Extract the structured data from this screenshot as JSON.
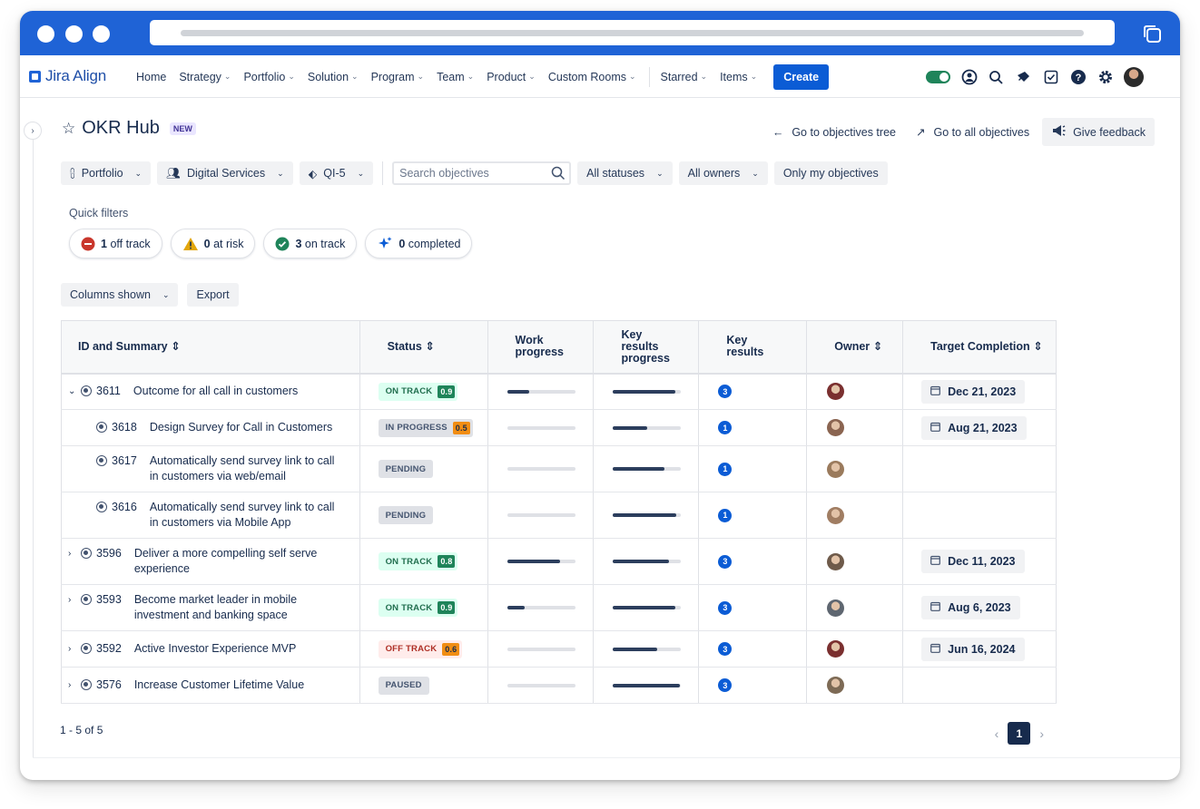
{
  "app": {
    "logo": "Jira Align"
  },
  "nav": {
    "items": [
      {
        "label": "Home",
        "dropdown": false
      },
      {
        "label": "Strategy",
        "dropdown": true
      },
      {
        "label": "Portfolio",
        "dropdown": true
      },
      {
        "label": "Solution",
        "dropdown": true
      },
      {
        "label": "Program",
        "dropdown": true
      },
      {
        "label": "Team",
        "dropdown": true
      },
      {
        "label": "Product",
        "dropdown": true
      },
      {
        "label": "Custom Rooms",
        "dropdown": true
      }
    ],
    "starred": "Starred",
    "items_menu": "Items",
    "create": "Create"
  },
  "page": {
    "title": "OKR Hub",
    "badge": "NEW",
    "go_tree": "Go to objectives tree",
    "go_all": "Go to all objectives",
    "feedback": "Give feedback"
  },
  "filters": {
    "portfolio": "Portfolio",
    "digital": "Digital Services",
    "pi": "QI-5",
    "search_placeholder": "Search objectives",
    "statuses": "All statuses",
    "owners": "All owners",
    "mine": "Only my objectives"
  },
  "quick_filters": {
    "label": "Quick filters",
    "chips": [
      {
        "count": "1",
        "label": "off track",
        "icon": "off-track-icon",
        "color": "#c9372c"
      },
      {
        "count": "0",
        "label": "at risk",
        "icon": "warning-icon",
        "color": "#e2a60b"
      },
      {
        "count": "3",
        "label": "on track",
        "icon": "check-circle-icon",
        "color": "#1f845a"
      },
      {
        "count": "0",
        "label": "completed",
        "icon": "sparkle-icon",
        "color": "#0b5cd5"
      }
    ]
  },
  "tools": {
    "columns": "Columns shown",
    "export": "Export"
  },
  "table": {
    "headers": {
      "id": "ID and Summary",
      "status": "Status",
      "work": [
        "Work",
        "progress"
      ],
      "krp": [
        "Key",
        "results",
        "progress"
      ],
      "kr": [
        "Key",
        "results"
      ],
      "owner": "Owner",
      "target": "Target Completion"
    },
    "rows": [
      {
        "expander": "expanded",
        "indent": 0,
        "id": "3611",
        "summary": [
          "Outcome for all call in customers"
        ],
        "status": "ON TRACK",
        "score": "0.9",
        "status_kind": "ontrack",
        "work": 0.33,
        "krp": 0.92,
        "kr": "3",
        "avatar": "#7a2f2f",
        "date": "Dec 21, 2023",
        "tall": false
      },
      {
        "expander": "none",
        "indent": 1,
        "id": "3618",
        "summary": [
          "Design Survey for Call in Customers"
        ],
        "status": "IN PROGRESS",
        "score": "0.5",
        "status_kind": "inprog",
        "work": 0.0,
        "krp": 0.5,
        "kr": "1",
        "avatar": "#8a6450",
        "date": "Aug 21, 2023",
        "tall": false
      },
      {
        "expander": "none",
        "indent": 1,
        "id": "3617",
        "summary": [
          "Automatically send survey link to call",
          "in customers via web/email"
        ],
        "status": "PENDING",
        "score": "",
        "status_kind": "plain",
        "work": 0.0,
        "krp": 0.76,
        "kr": "1",
        "avatar": "#9a7a5c",
        "date": "",
        "tall": true
      },
      {
        "expander": "none",
        "indent": 1,
        "id": "3616",
        "summary": [
          "Automatically send survey link to call",
          "in customers via Mobile App"
        ],
        "status": "PENDING",
        "score": "",
        "status_kind": "plain",
        "work": 0.0,
        "krp": 0.93,
        "kr": "1",
        "avatar": "#a07d62",
        "date": "",
        "tall": true
      },
      {
        "expander": "collapsed",
        "indent": 0,
        "id": "3596",
        "summary": [
          "Deliver a more compelling self serve",
          "experience"
        ],
        "status": "ON TRACK",
        "score": "0.8",
        "status_kind": "ontrack",
        "work": 0.78,
        "krp": 0.82,
        "kr": "3",
        "avatar": "#6e5a4a",
        "date": "Dec 11, 2023",
        "tall": true
      },
      {
        "expander": "collapsed",
        "indent": 0,
        "id": "3593",
        "summary": [
          "Become market leader in mobile",
          "investment and banking space"
        ],
        "status": "ON TRACK",
        "score": "0.9",
        "status_kind": "ontrack",
        "work": 0.26,
        "krp": 0.92,
        "kr": "3",
        "avatar": "#5e6670",
        "date": "Aug 6, 2023",
        "tall": true
      },
      {
        "expander": "collapsed",
        "indent": 0,
        "id": "3592",
        "summary": [
          "Active Investor Experience MVP"
        ],
        "status": "OFF TRACK",
        "score": "0.6",
        "status_kind": "offtrack",
        "work": 0.0,
        "krp": 0.65,
        "kr": "3",
        "avatar": "#7a2f2f",
        "date": "Jun 16, 2024",
        "tall": false
      },
      {
        "expander": "collapsed",
        "indent": 0,
        "id": "3576",
        "summary": [
          "Increase Customer Lifetime Value"
        ],
        "status": "PAUSED",
        "score": "",
        "status_kind": "plain",
        "work": 0.0,
        "krp": 0.98,
        "kr": "3",
        "avatar": "#7d6a55",
        "date": "",
        "tall": false
      }
    ]
  },
  "pagination": {
    "info": "1 - 5 of 5",
    "current": "1"
  }
}
